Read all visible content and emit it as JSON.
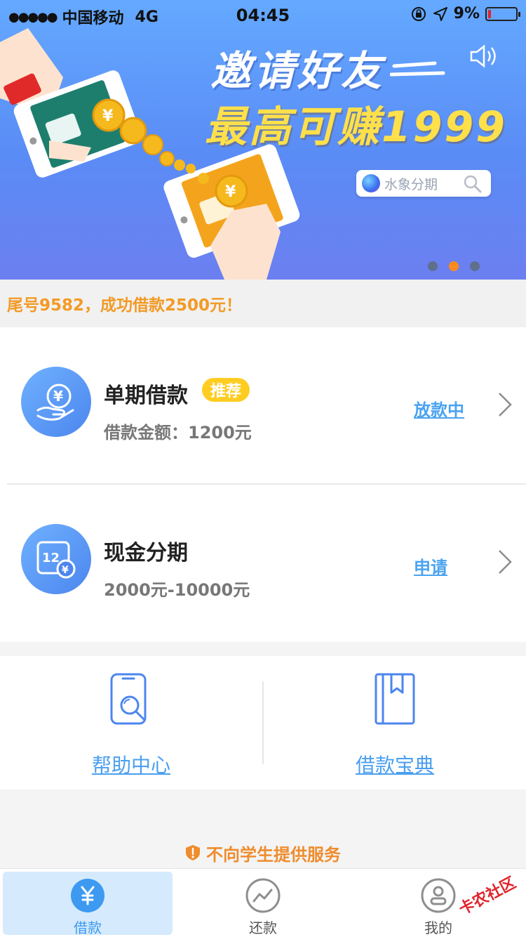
{
  "status_bar": {
    "signal": "●●●●●",
    "carrier": "中国移动",
    "network": "4G",
    "time": "04:45",
    "battery": "9%",
    "battery_level": 0.09
  },
  "banner": {
    "title": "邀请好友",
    "subtitle": "最高可赚1999",
    "search_brand": "水象分期",
    "dots_count": 3,
    "active_dot": 2
  },
  "notice": {
    "text": "尾号9582，成功借款2500元！"
  },
  "loans": [
    {
      "title": "单期借款",
      "badge": "推荐",
      "desc": "借款金额：1200元",
      "action": "放款中"
    },
    {
      "title": "现金分期",
      "desc": "2000元-10000元",
      "action": "申请"
    }
  ],
  "quick_links": {
    "help": "帮助中心",
    "guide": "借款宝典"
  },
  "student_notice": "不向学生提供服务",
  "tabs": [
    {
      "label": "借款",
      "icon": "yuan-icon",
      "active": true
    },
    {
      "label": "还款",
      "icon": "trend-icon",
      "active": false
    },
    {
      "label": "我的",
      "icon": "user-icon",
      "active": false
    }
  ],
  "watermark": "卡农社区",
  "colors": {
    "accent": "#4aa3f0",
    "orange": "#f39a25",
    "badge": "#ffcd22",
    "banner_yellow": "#ffe04a"
  }
}
